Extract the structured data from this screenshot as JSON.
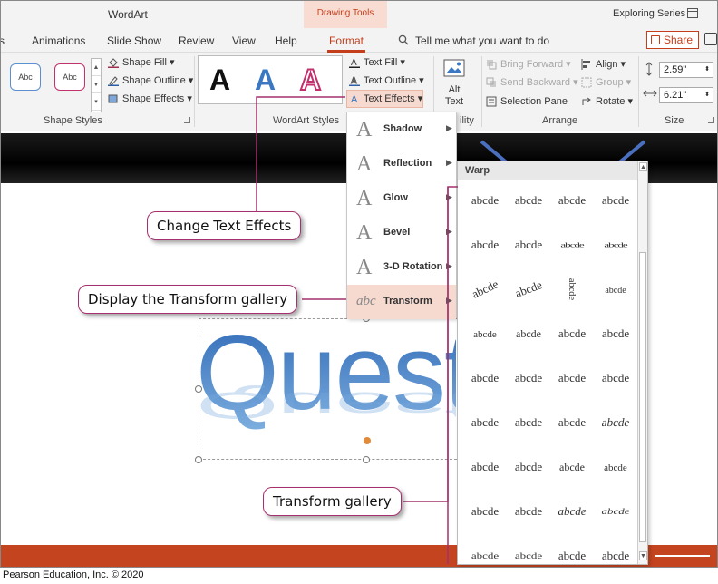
{
  "titlebar": {
    "app_title": "WordArt",
    "context_tab": "Drawing Tools",
    "series": "Exploring Series"
  },
  "menu": {
    "items": [
      "s",
      "Animations",
      "Slide Show",
      "Review",
      "View",
      "Help",
      "Format"
    ],
    "active": "Format",
    "search_placeholder": "Tell me what you want to do",
    "share_label": "Share"
  },
  "ribbon": {
    "shape_styles": {
      "thumb_label": "Abc",
      "fill": "Shape Fill",
      "outline": "Shape Outline",
      "effects": "Shape Effects",
      "group_label": "Shape Styles"
    },
    "wordart_styles": {
      "sample_letter": "A",
      "text_fill": "Text Fill",
      "text_outline": "Text Outline",
      "text_effects": "Text Effects",
      "group_label": "WordArt Styles"
    },
    "accessibility": {
      "alt_text_line1": "Alt",
      "alt_text_line2": "Text",
      "group_label_partial": "ility"
    },
    "arrange": {
      "bring_forward": "Bring Forward",
      "send_backward": "Send Backward",
      "selection_pane": "Selection Pane",
      "align": "Align",
      "group": "Group",
      "rotate": "Rotate",
      "group_label": "Arrange"
    },
    "size": {
      "height": "2.59\"",
      "width": "6.21\"",
      "group_label": "Size"
    }
  },
  "text_effects_menu": [
    {
      "label": "Shadow",
      "letter": "A"
    },
    {
      "label": "Reflection",
      "letter": "A"
    },
    {
      "label": "Glow",
      "letter": "A"
    },
    {
      "label": "Bevel",
      "letter": "A"
    },
    {
      "label": "3-D Rotation",
      "letter": "A"
    },
    {
      "label": "Transform",
      "letter": "abc"
    }
  ],
  "transform_gallery": {
    "header": "Warp",
    "sample": "abcde",
    "rows": 9,
    "cols": 4
  },
  "slide": {
    "wordart_text": "Questio"
  },
  "callouts": {
    "change_text_effects": "Change Text Effects",
    "display_transform": "Display the Transform gallery",
    "transform_gallery": "Transform gallery"
  },
  "credit": "Pearson Education, Inc. © 2020",
  "colors": {
    "accent": "#c43e1c",
    "callout_border": "#a4316d",
    "wordart_blue": "#3b78c1",
    "footer": "#c4441f"
  }
}
